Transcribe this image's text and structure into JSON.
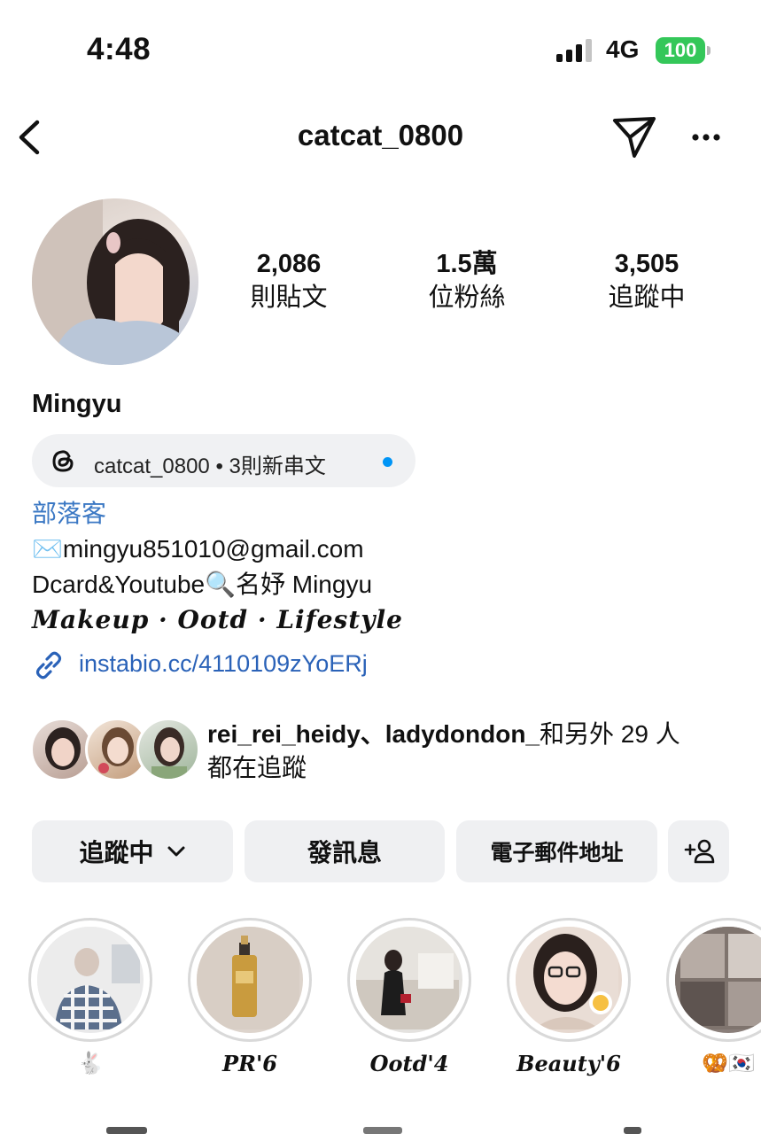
{
  "status_bar": {
    "time": "4:48",
    "network": "4G",
    "battery": "100"
  },
  "header": {
    "username": "catcat_0800"
  },
  "profile": {
    "stats": [
      {
        "value": "2,086",
        "label": "則貼文"
      },
      {
        "value": "1.5萬",
        "label": "位粉絲"
      },
      {
        "value": "3,505",
        "label": "追蹤中"
      }
    ],
    "display_name": "Mingyu",
    "threads_badge": "catcat_0800 • 3則新串文",
    "bio": {
      "category": "部落客",
      "email_line": "✉️mingyu851010@gmail.com",
      "youtube_line": "Dcard&Youtube🔍名妤 Mingyu",
      "tagline": "Makeup · Ootd · Lifestyle",
      "link": "instabio.cc/4110109zYoERj"
    },
    "followed_by": {
      "names": "rei_rei_heidy、ladydondon_",
      "suffix": "和另外 29 人",
      "line2": "都在追蹤"
    }
  },
  "actions": {
    "follow_label": "追蹤中",
    "message_label": "發訊息",
    "email_label": "電子郵件地址"
  },
  "highlights": [
    {
      "label": "🐇"
    },
    {
      "label": "PR'6"
    },
    {
      "label": "Ootd'4"
    },
    {
      "label": "Beauty'6"
    },
    {
      "label": "🥨🇰🇷"
    }
  ],
  "colors": {
    "link_blue": "#2a62b8",
    "category_blue": "#3b78c4",
    "battery_green": "#34c759",
    "button_gray": "#eff0f2",
    "unread_dot": "#0095f6"
  },
  "icons": [
    "back-chevron-icon",
    "send-icon",
    "more-icon",
    "threads-icon",
    "link-icon",
    "chevron-down-icon",
    "add-person-icon"
  ]
}
